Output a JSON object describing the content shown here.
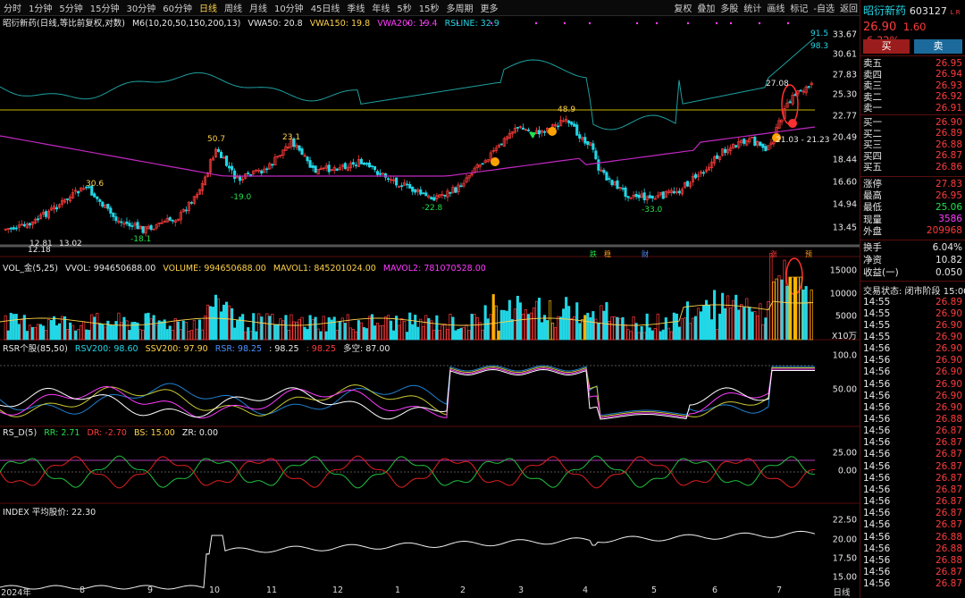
{
  "toolbar": {
    "periods": [
      "分时",
      "1分钟",
      "5分钟",
      "15分钟",
      "30分钟",
      "60分钟",
      "日线",
      "周线",
      "月线",
      "10分钟",
      "45日线",
      "季线",
      "年线",
      "5秒",
      "15秒",
      "多周期",
      "更多"
    ],
    "active_period": "日线",
    "tools": [
      "复权",
      "叠加",
      "多股",
      "统计",
      "画线",
      "标记",
      "-自选",
      "返回"
    ]
  },
  "main_info": {
    "stock_label": "昭衍新药(日线,等比前复权,对数)",
    "m6": "M6(10,20,50,150,200,13)",
    "vwa50": "VWA50: 20.8",
    "vwa150": "VWA150: 19.8",
    "vwa200": "VWA200: 19.4",
    "rsline": "RSLINE: 32.9"
  },
  "price_axis": [
    "33.67",
    "30.61",
    "27.83",
    "25.30",
    "22.77",
    "20.49",
    "18.44",
    "16.60",
    "14.94",
    "13.45"
  ],
  "chart_annotations": {
    "high1": "50.7",
    "high2": "23.1",
    "low1": "-19.0",
    "low2": "30.6",
    "low3": "-18.1",
    "low4": "-22.8",
    "high3": "48.9",
    "low5": "-33.0",
    "bot1": "12.81",
    "bot2": "13.02",
    "bot3": "12.18",
    "recent": "27.08",
    "r1": "21.03 - 21.23",
    "rs1": "91.5",
    "rs2": "98.3"
  },
  "event_tags": [
    "跌",
    "稳",
    "财",
    "涨",
    "预"
  ],
  "vol_info": {
    "label": "VOL_金(5,25)",
    "vvol": "VVOL: 994650688.00",
    "volume": "VOLUME: 994650688.00",
    "mavol1": "MAVOL1: 845201024.00",
    "mavol2": "MAVOL2: 781070528.00"
  },
  "vol_axis": [
    "15000",
    "10000",
    "5000",
    "X10万"
  ],
  "rsr_info": {
    "label": "RSR个股(85,50)",
    "rsv200": "RSV200: 98.60",
    "ssv200": "SSV200: 97.90",
    "rsr": "RSR: 98.25",
    "rsr2": ": 98.25",
    "rsr3": ": 98.25",
    "duokong": "多空: 87.00"
  },
  "rsr_axis": [
    "100.0",
    "50.00"
  ],
  "rsd_info": {
    "label": "RS_D(5)",
    "rr": "RR: 2.71",
    "dr": "DR: -2.70",
    "bs": "BS: 15.00",
    "zr": "ZR: 0.00"
  },
  "rsd_axis": [
    "25.00",
    "0.00"
  ],
  "index_info": {
    "label": "INDEX 平均股价: 22.30"
  },
  "index_axis": [
    "22.50",
    "20.00",
    "17.50",
    "15.00"
  ],
  "date_axis": [
    "2024年",
    "8",
    "9",
    "10",
    "11",
    "12",
    "1",
    "2",
    "3",
    "4",
    "5",
    "6",
    "7"
  ],
  "date_axis_right": "日线",
  "side": {
    "name": "昭衍新药",
    "code": "603127",
    "flags": "L R",
    "price": "26.90",
    "change": "1.60",
    "pct": "6.32%",
    "buy_label": "买",
    "sell_label": "卖",
    "asks": [
      {
        "label": "卖五",
        "price": "26.95"
      },
      {
        "label": "卖四",
        "price": "26.94"
      },
      {
        "label": "卖三",
        "price": "26.93"
      },
      {
        "label": "卖二",
        "price": "26.92"
      },
      {
        "label": "卖一",
        "price": "26.91"
      }
    ],
    "bids": [
      {
        "label": "买一",
        "price": "26.90"
      },
      {
        "label": "买二",
        "price": "26.89"
      },
      {
        "label": "买三",
        "price": "26.88"
      },
      {
        "label": "买四",
        "price": "26.87"
      },
      {
        "label": "买五",
        "price": "26.86"
      }
    ],
    "stats": [
      {
        "label": "涨停",
        "value": "27.83",
        "color": "red"
      },
      {
        "label": "最高",
        "value": "26.95",
        "color": "red"
      },
      {
        "label": "最低",
        "value": "25.06",
        "color": "green"
      },
      {
        "label": "现量",
        "value": "3586",
        "color": "magenta"
      },
      {
        "label": "外盘",
        "value": "209968",
        "color": "red"
      }
    ],
    "stats2": [
      {
        "label": "换手",
        "value": "6.04%"
      },
      {
        "label": "净资",
        "value": "10.82"
      },
      {
        "label": "收益(一)",
        "value": "0.050"
      }
    ],
    "trade_status": "交易状态: 闭市阶段 15:00",
    "ticks": [
      {
        "t": "14:55",
        "p": "26.89"
      },
      {
        "t": "14:55",
        "p": "26.90"
      },
      {
        "t": "14:55",
        "p": "26.90"
      },
      {
        "t": "14:55",
        "p": "26.90"
      },
      {
        "t": "14:56",
        "p": "26.90"
      },
      {
        "t": "14:56",
        "p": "26.90"
      },
      {
        "t": "14:56",
        "p": "26.90"
      },
      {
        "t": "14:56",
        "p": "26.90"
      },
      {
        "t": "14:56",
        "p": "26.90"
      },
      {
        "t": "14:56",
        "p": "26.90"
      },
      {
        "t": "14:56",
        "p": "26.88"
      },
      {
        "t": "14:56",
        "p": "26.87"
      },
      {
        "t": "14:56",
        "p": "26.87"
      },
      {
        "t": "14:56",
        "p": "26.87"
      },
      {
        "t": "14:56",
        "p": "26.87"
      },
      {
        "t": "14:56",
        "p": "26.87"
      },
      {
        "t": "14:56",
        "p": "26.87"
      },
      {
        "t": "14:56",
        "p": "26.87"
      },
      {
        "t": "14:56",
        "p": "26.87"
      },
      {
        "t": "14:56",
        "p": "26.87"
      },
      {
        "t": "14:56",
        "p": "26.88"
      },
      {
        "t": "14:56",
        "p": "26.88"
      },
      {
        "t": "14:56",
        "p": "26.88"
      },
      {
        "t": "14:56",
        "p": "26.87"
      },
      {
        "t": "14:56",
        "p": "26.87"
      }
    ]
  }
}
